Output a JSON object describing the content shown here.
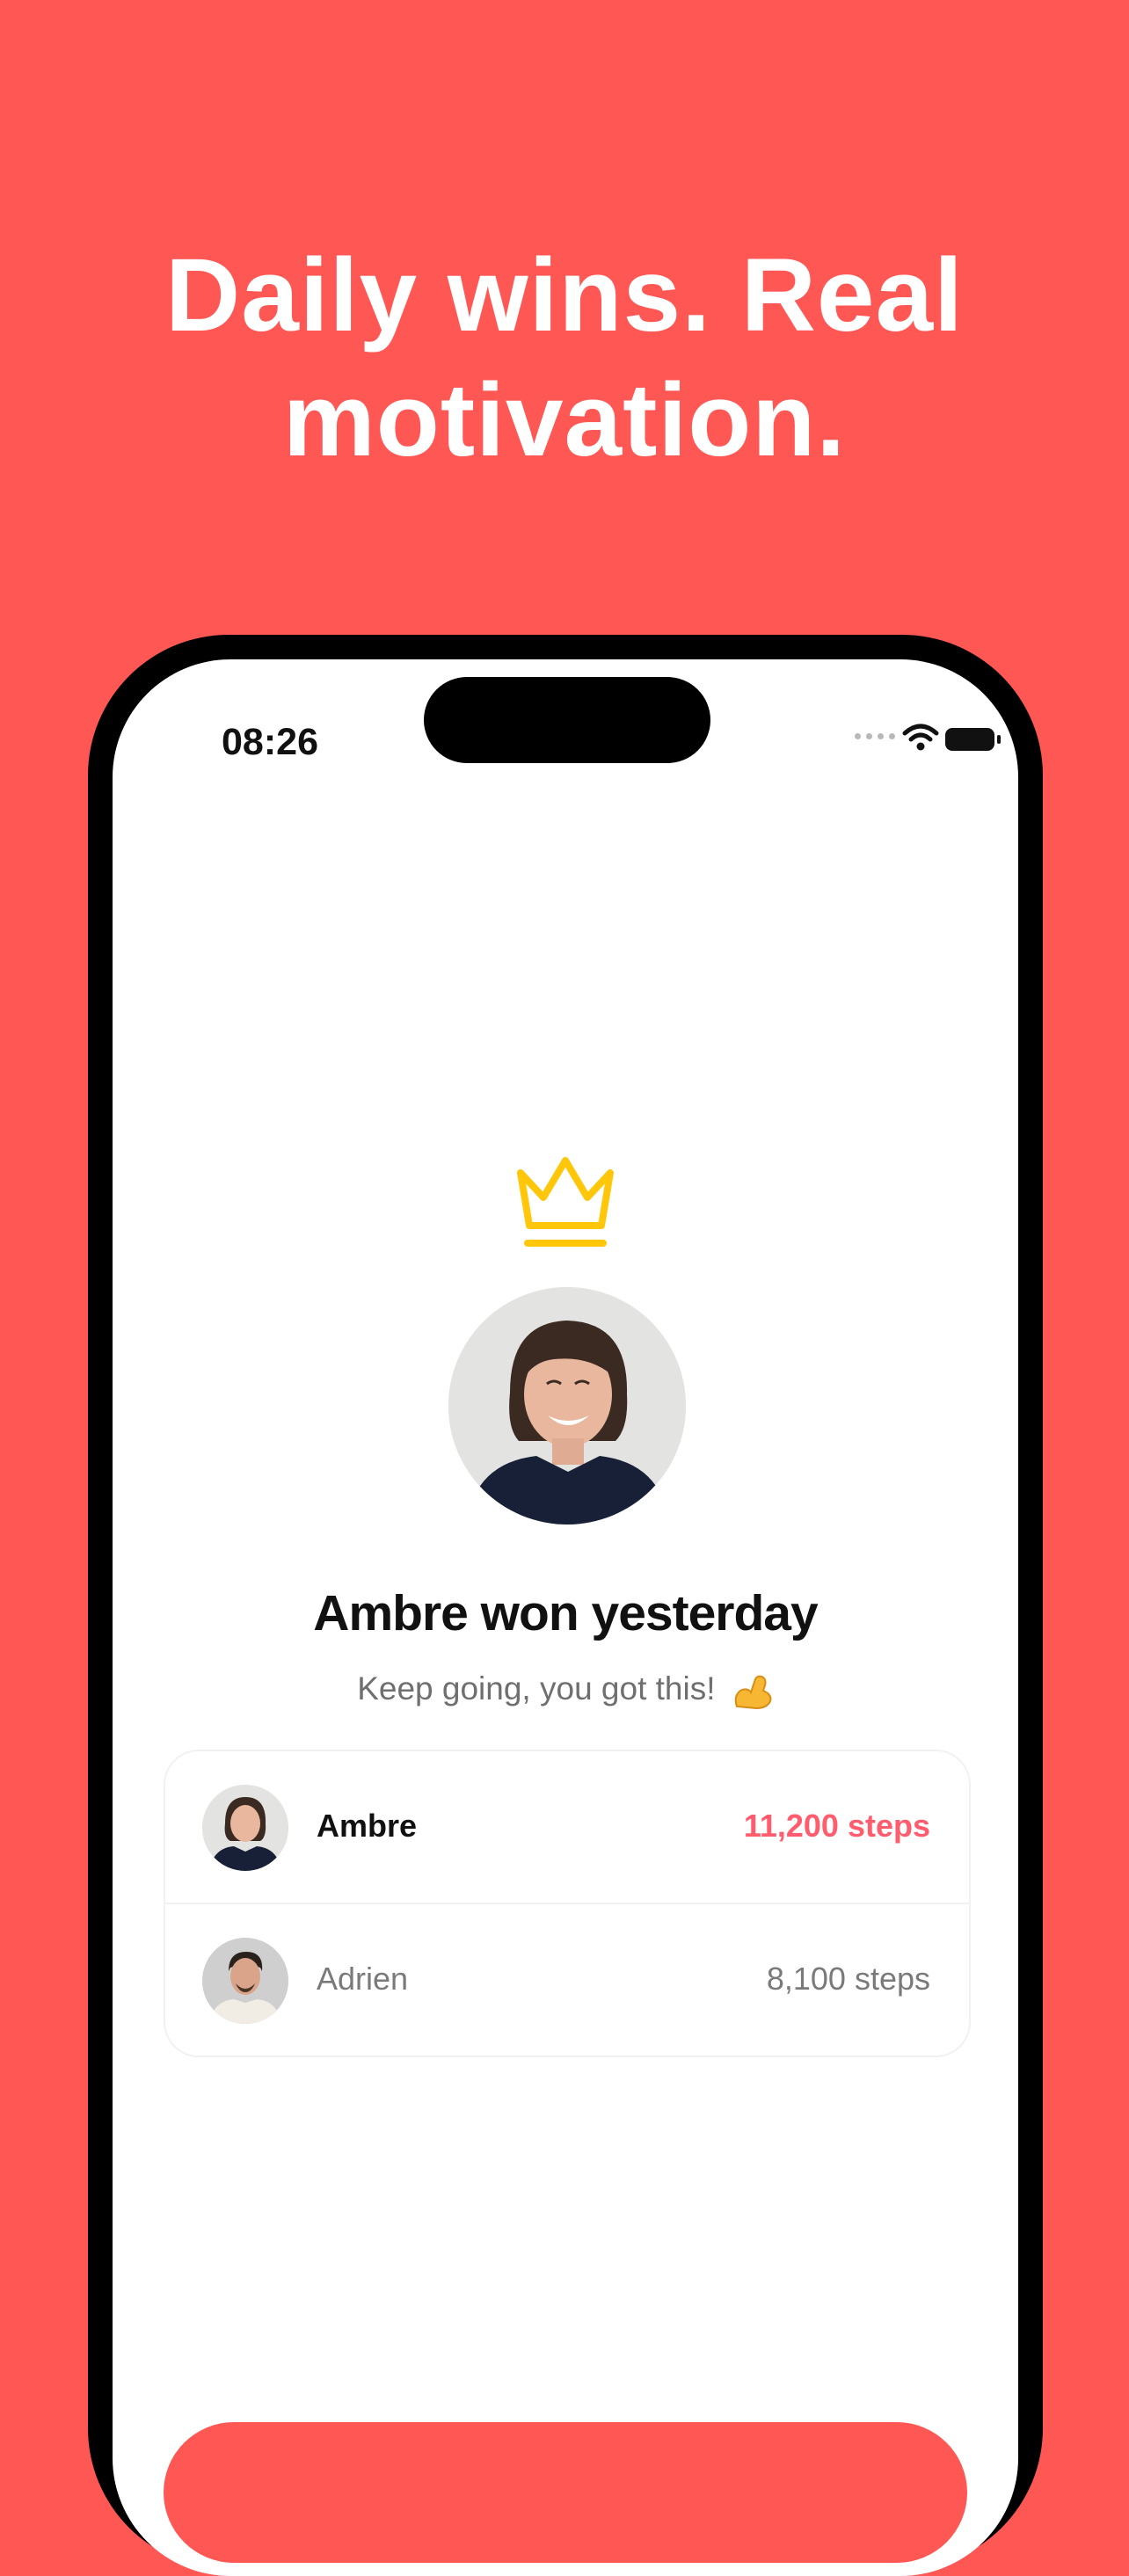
{
  "promo": {
    "headline_line1": "Daily wins. Real",
    "headline_line2": "motivation."
  },
  "status_bar": {
    "time": "08:26"
  },
  "winner": {
    "title": "Ambre won yesterday",
    "subtitle": "Keep going, you got this!",
    "emoji": "flexed-biceps-icon"
  },
  "leaderboard": {
    "rows": [
      {
        "name": "Ambre",
        "steps": "11,200 steps"
      },
      {
        "name": "Adrien",
        "steps": "8,100 steps"
      }
    ]
  },
  "colors": {
    "background": "#FF5754",
    "crown": "#FFC60A",
    "leader_steps": "#FF5C6E",
    "text_muted": "#7a7a7a"
  }
}
